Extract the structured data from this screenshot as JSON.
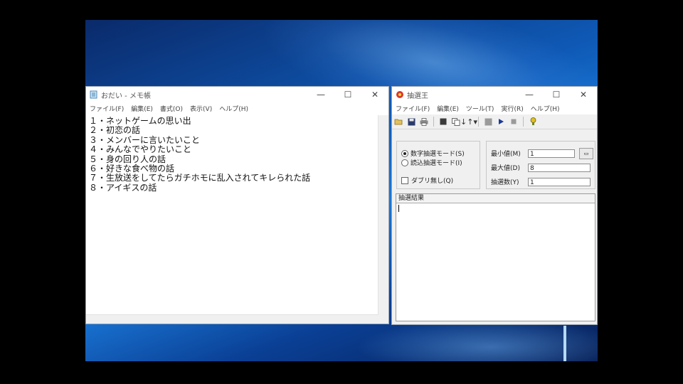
{
  "notepad": {
    "title": "おだい - メモ帳",
    "menu": [
      "ファイル(F)",
      "編集(E)",
      "書式(O)",
      "表示(V)",
      "ヘルプ(H)"
    ],
    "lines": [
      "１・ネットゲームの思い出",
      "２・初恋の話",
      "３・メンバーに言いたいこと",
      "４・みんなでやりたいこと",
      "５・身の回り人の話",
      "６・好きな食べ物の話",
      "７・生放送をしてたらガチホモに乱入されてキレられた話",
      "８・アイギスの話"
    ]
  },
  "chusen": {
    "title": "抽選王",
    "menu": [
      "ファイル(F)",
      "編集(E)",
      "ツール(T)",
      "実行(R)",
      "ヘルプ(H)"
    ],
    "modes": {
      "number_mode": "数字抽選モード(S)",
      "load_mode": "読込抽選モード(I)",
      "no_duplicate": "ダブリ無し(Q)"
    },
    "params": {
      "min_label": "最小値(M)",
      "min_value": "1",
      "max_label": "最大値(D)",
      "max_value": "8",
      "count_label": "抽選数(Y)",
      "count_value": "1"
    },
    "result_header": "抽選結果"
  },
  "colors": {
    "desktop_blue": "#0f5bb8",
    "window_border": "#9aa6b4"
  }
}
